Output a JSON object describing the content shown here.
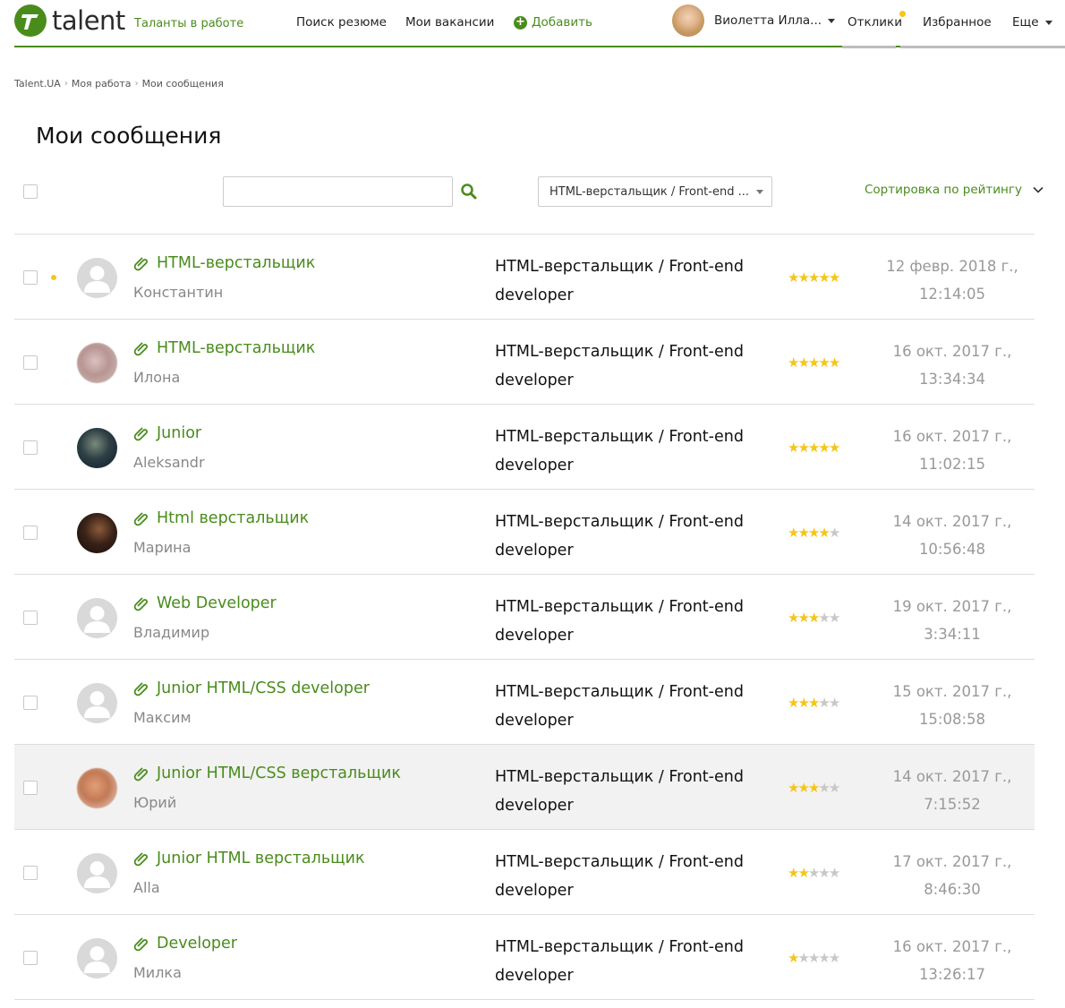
{
  "header": {
    "logo_text": "talent",
    "tagline": "Таланты в работе",
    "nav": {
      "search_resume": "Поиск резюме",
      "my_vacancies": "Мои вакансии",
      "add": "Добавить",
      "responses": "Отклики",
      "favorites": "Избранное",
      "more": "Еще"
    },
    "user_name": "Виолетта Илла..."
  },
  "breadcrumb": [
    "Talent.UA",
    "Моя работа",
    "Мои сообщения"
  ],
  "page_title": "Мои сообщения",
  "toolbar": {
    "search_value": "",
    "filter_selected": "HTML-верстальщик / Front-end developer",
    "filter_display": "HTML-верстальщик / Front-end ...",
    "sort_label": "Сортировка по рейтингу"
  },
  "messages": [
    {
      "title": "HTML-верстальщик",
      "name": "Константин",
      "vacancy": "HTML-верстальщик / Front-end developer",
      "rating": 5,
      "date": "12 февр. 2018 г.,",
      "time": "12:14:05",
      "unread": true,
      "avatar": "default"
    },
    {
      "title": "HTML-верстальщик",
      "name": "Илона",
      "vacancy": "HTML-верстальщик / Front-end developer",
      "rating": 5,
      "date": "16 окт. 2017 г.,",
      "time": "13:34:34",
      "unread": false,
      "avatar": "photo"
    },
    {
      "title": "Junior",
      "name": "Aleksandr",
      "vacancy": "HTML-верстальщик / Front-end developer",
      "rating": 5,
      "date": "16 окт. 2017 г.,",
      "time": "11:02:15",
      "unread": false,
      "avatar": "photo"
    },
    {
      "title": "Html верстальщик",
      "name": "Марина",
      "vacancy": "HTML-верстальщик / Front-end developer",
      "rating": 4,
      "date": "14 окт. 2017 г.,",
      "time": "10:56:48",
      "unread": false,
      "avatar": "photo"
    },
    {
      "title": "Web Developer",
      "name": "Владимир",
      "vacancy": "HTML-верстальщик / Front-end developer",
      "rating": 3,
      "date": "19 окт. 2017 г.,",
      "time": "3:34:11",
      "unread": false,
      "avatar": "default"
    },
    {
      "title": "Junior HTML/CSS developer",
      "name": "Максим",
      "vacancy": "HTML-верстальщик / Front-end developer",
      "rating": 3,
      "date": "15 окт. 2017 г.,",
      "time": "15:08:58",
      "unread": false,
      "avatar": "default"
    },
    {
      "title": "Junior HTML/CSS верстальщик",
      "name": "Юрий",
      "vacancy": "HTML-верстальщик / Front-end developer",
      "rating": 3,
      "date": "14 окт. 2017 г.,",
      "time": "7:15:52",
      "unread": false,
      "avatar": "photo"
    },
    {
      "title": "Junior HTML верстальщик",
      "name": "Alla",
      "vacancy": "HTML-верстальщик / Front-end developer",
      "rating": 2,
      "date": "17 окт. 2017 г.,",
      "time": "8:46:30",
      "unread": false,
      "avatar": "default"
    },
    {
      "title": "Developer",
      "name": "Милка",
      "vacancy": "HTML-верстальщик / Front-end developer",
      "rating": 1,
      "date": "16 окт. 2017 г.,",
      "time": "13:26:17",
      "unread": false,
      "avatar": "default"
    }
  ],
  "colors": {
    "accent": "#4a8c1c",
    "star": "#f5c518",
    "unread_dot": "#f5c518"
  },
  "icons": [
    "logo-icon",
    "plus-icon",
    "caret-down-icon",
    "search-icon",
    "chevron-down-icon",
    "paperclip-icon",
    "user-placeholder-icon",
    "star-icon"
  ]
}
